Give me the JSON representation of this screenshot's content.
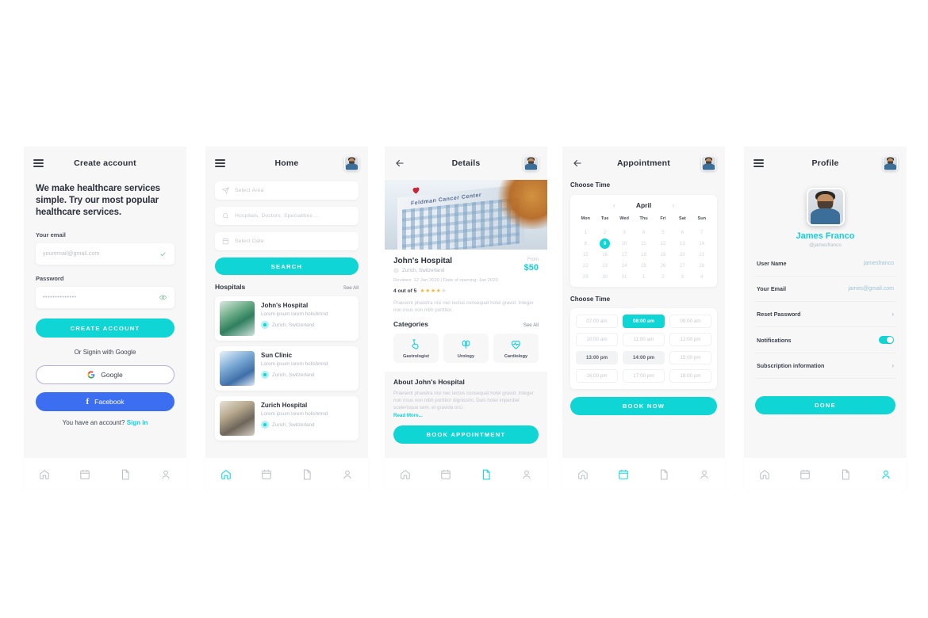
{
  "accent": "#0fd5d5",
  "screens": {
    "create_account": {
      "title": "Create account",
      "headline": "We make healthcare services simple. Try our most popular healthcare services.",
      "email_label": "Your email",
      "email_placeholder": "youremail@gmail.com",
      "password_label": "Password",
      "password_value": "••••••••••••••",
      "create_button": "CREATE ACCOUNT",
      "or_text": "Or Signin with Google",
      "google_button": "Google",
      "facebook_button": "Facebook",
      "footer_text": "You have an account?",
      "footer_link": "Sign in"
    },
    "home": {
      "title": "Home",
      "search_area_placeholder": "Select Area",
      "search_query_placeholder": "Hospitals, Doctors, Specialities ...",
      "search_date_placeholder": "Select Date",
      "search_button": "SEARCH",
      "section_title": "Hospitals",
      "see_all": "See All",
      "hospitals": [
        {
          "name": "John's Hospital",
          "desc": "Lorem ipsum lorem holishmnd",
          "location": "Zurich, Switzerland"
        },
        {
          "name": "Sun Clinic",
          "desc": "Lorem ipsum lorem holishmnd",
          "location": "Zurich, Switzerland"
        },
        {
          "name": "Zurich Hospital",
          "desc": "Lorem ipsum lorem holishmnd",
          "location": "Zurich, Switzerland"
        }
      ]
    },
    "details": {
      "title": "Details",
      "hero_sign": "Feldman Cancer Center",
      "hospital_name": "John's Hospital",
      "location": "Zurich, Switzerland",
      "from_label": "From",
      "price": "$50",
      "meta": "Reviews: 12 Jan 2020 | Date of opening: Jan 2020",
      "rating_text": "4 out of 5",
      "rating_value": 4,
      "rating_max": 5,
      "short_desc": "Praesent pharetra nisi nec lectus consequat hotel gravid. Integer non risus non nibh porttitor.",
      "categories_title": "Categories",
      "categories_see_all": "See All",
      "categories": [
        {
          "label": "Gastrologist",
          "icon": "stomach-icon"
        },
        {
          "label": "Urology",
          "icon": "kidney-icon"
        },
        {
          "label": "Cardiology",
          "icon": "heart-pulse-icon"
        }
      ],
      "about_title": "About John's Hospital",
      "about_text": "Praesent pharetra nisi nec lectus consequat hotel gravid. Integer non risus non nibh porttitor dignissim. Duis hotel imperdiet scelerisque sem, et gravida orci.",
      "read_more": "Read More...",
      "cta": "BOOK APPOINTMENT"
    },
    "appointment": {
      "title": "Appointment",
      "choose_date_label": "Choose Time",
      "month": "April",
      "prev": "‹",
      "next": "›",
      "weekdays": [
        "Mon",
        "Tue",
        "Wed",
        "Thu",
        "Fri",
        "Sat",
        "Sun"
      ],
      "weeks": [
        [
          "1",
          "2",
          "3",
          "4",
          "5",
          "6",
          "7"
        ],
        [
          "8",
          "9",
          "10",
          "11",
          "12",
          "13",
          "14"
        ],
        [
          "15",
          "16",
          "17",
          "18",
          "19",
          "20",
          "21"
        ],
        [
          "22",
          "23",
          "24",
          "25",
          "26",
          "27",
          "28"
        ],
        [
          "29",
          "30",
          "31",
          "1",
          "2",
          "3",
          "4"
        ]
      ],
      "selected_day": "9",
      "choose_time_label": "Choose Time",
      "slots": [
        {
          "label": "07:00 am",
          "state": "normal"
        },
        {
          "label": "08:00 am",
          "state": "selected"
        },
        {
          "label": "09:00 am",
          "state": "normal"
        },
        {
          "label": "10:00 am",
          "state": "normal"
        },
        {
          "label": "11:00 am",
          "state": "normal"
        },
        {
          "label": "12:00 pm",
          "state": "normal"
        },
        {
          "label": "13:00 pm",
          "state": "gray"
        },
        {
          "label": "14:00 pm",
          "state": "gray"
        },
        {
          "label": "15:00 pm",
          "state": "normal"
        },
        {
          "label": "16:00 pm",
          "state": "normal"
        },
        {
          "label": "17:00 pm",
          "state": "normal"
        },
        {
          "label": "18:00 pm",
          "state": "normal"
        }
      ],
      "cta": "BOOK NOW"
    },
    "profile": {
      "title": "Profile",
      "name": "James Franco",
      "handle": "@jamesfranco",
      "rows": [
        {
          "key": "User Name",
          "value": "jamesfranco",
          "type": "value"
        },
        {
          "key": "Your Email",
          "value": "james@gmail.com",
          "type": "value"
        },
        {
          "key": "Reset Password",
          "value": "›",
          "type": "chevron"
        },
        {
          "key": "Notifications",
          "value": "on",
          "type": "toggle"
        },
        {
          "key": "Subscription information",
          "value": "›",
          "type": "chevron"
        }
      ],
      "cta": "DONE"
    }
  },
  "nav": {
    "items": [
      "home-icon",
      "calendar-icon",
      "document-icon",
      "person-icon"
    ],
    "active": [
      null,
      0,
      2,
      1,
      3
    ]
  }
}
